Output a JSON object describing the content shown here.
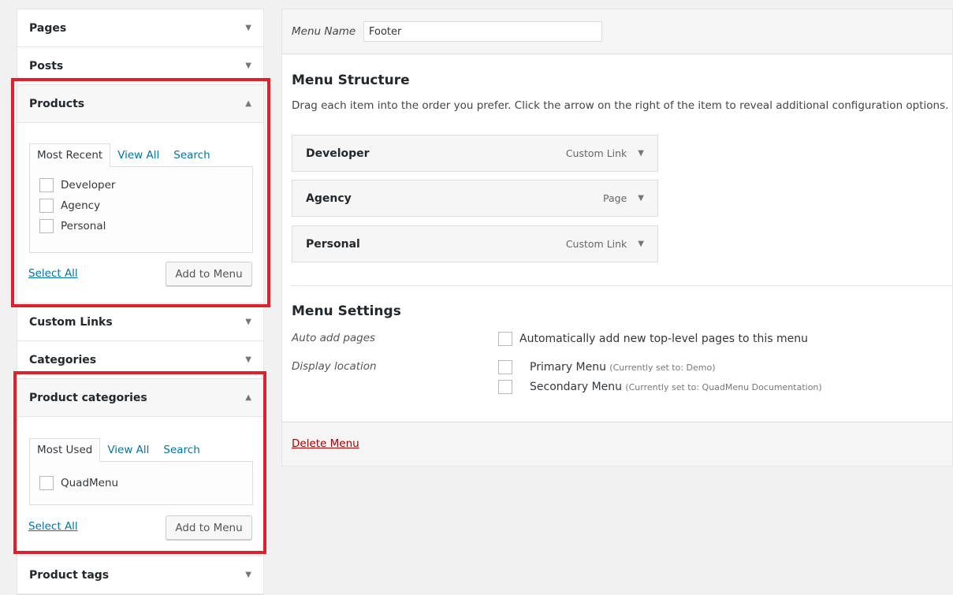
{
  "sidebar": {
    "pages": "Pages",
    "posts": "Posts",
    "products": "Products",
    "custom_links": "Custom Links",
    "categories": "Categories",
    "product_categories": "Product categories",
    "product_tags": "Product tags",
    "products_box": {
      "tabs": [
        "Most Recent",
        "View All",
        "Search"
      ],
      "items": [
        "Developer",
        "Agency",
        "Personal"
      ],
      "select_all": "Select All",
      "add": "Add to Menu"
    },
    "prodcat_box": {
      "tabs": [
        "Most Used",
        "View All",
        "Search"
      ],
      "items": [
        "QuadMenu"
      ],
      "select_all": "Select All",
      "add": "Add to Menu"
    }
  },
  "main": {
    "menu_name_label": "Menu Name",
    "menu_name_value": "Footer",
    "structure_title": "Menu Structure",
    "structure_desc": "Drag each item into the order you prefer. Click the arrow on the right of the item to reveal additional configuration options.",
    "items": [
      {
        "title": "Developer",
        "type": "Custom Link"
      },
      {
        "title": "Agency",
        "type": "Page"
      },
      {
        "title": "Personal",
        "type": "Custom Link"
      }
    ],
    "settings_title": "Menu Settings",
    "auto_add_label": "Auto add pages",
    "auto_add_text": "Automatically add new top-level pages to this menu",
    "display_label": "Display location",
    "locations": [
      {
        "name": "Primary Menu",
        "note": "(Currently set to: Demo)"
      },
      {
        "name": "Secondary Menu",
        "note": "(Currently set to: QuadMenu Documentation)"
      }
    ],
    "delete": "Delete Menu"
  },
  "colors": {
    "highlight": "#e0202b",
    "link": "#0073aa",
    "delete": "#a00"
  }
}
